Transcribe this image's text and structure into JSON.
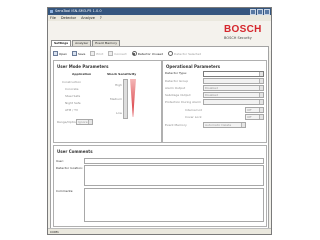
{
  "window": {
    "title": "SensTool ISN-SM3-P5 1.0.0"
  },
  "menu": [
    "File",
    "Detector",
    "Analyze",
    "?"
  ],
  "brand": {
    "logo": "BOSCH",
    "subtitle": "BOSCH Security"
  },
  "tabs": [
    "Settings",
    "Analyzer",
    "Event Memory"
  ],
  "toolbar": {
    "open": "Open",
    "save": "Save",
    "print": "Print",
    "connect": "Connect",
    "radio_unused": "Detector Unused",
    "radio_disabled": "Detector Selected"
  },
  "user_mode": {
    "title": "User Mode Parameters",
    "application_heading": "Application",
    "shock_heading": "Shock Sensitivity",
    "app_options": [
      "Construction",
      "Concrete",
      "Steel Safe",
      "Night Safe",
      "ATM / TV"
    ],
    "shock_options": [
      "High",
      "Medium",
      "Low"
    ],
    "range_label": "Range/Option",
    "range_value": "Ignore"
  },
  "operational": {
    "title": "Operational Parameters",
    "detector_type_label": "Detector Type:",
    "fields": [
      "Detector Group",
      "Alarm Output",
      "Sabotage Output",
      "Protection During Alarm",
      "Internal Lid",
      "Cover Lock",
      "Event Memory"
    ],
    "field_values": [
      "",
      "Disabled",
      "Disabled",
      "",
      "Off",
      "Off",
      "Automatic Delete"
    ]
  },
  "comments": {
    "title": "User Comments",
    "user_label": "User:",
    "location_label": "Detector location:",
    "comments_label": "Comments:"
  },
  "status": {
    "text": "COM1"
  },
  "colors": {
    "accent": "#d5262d",
    "titlebar": "#34557e"
  }
}
